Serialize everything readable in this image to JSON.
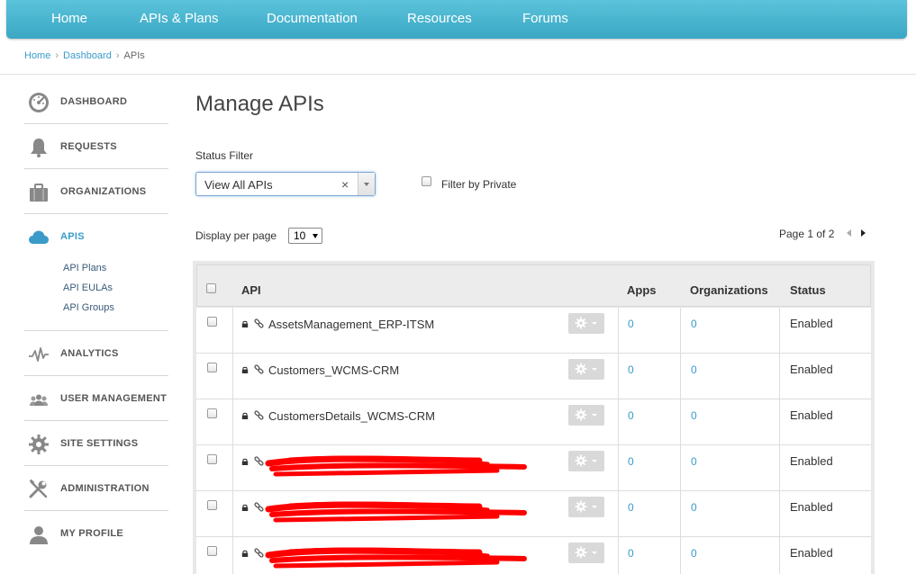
{
  "nav": {
    "items": [
      "Home",
      "APIs & Plans",
      "Documentation",
      "Resources",
      "Forums"
    ]
  },
  "breadcrumb": {
    "items": [
      "Home",
      "Dashboard",
      "APIs"
    ],
    "separator": "›"
  },
  "sidebar": {
    "items": [
      {
        "label": "DASHBOARD",
        "icon": "dashboard-icon"
      },
      {
        "label": "REQUESTS",
        "icon": "bell-icon"
      },
      {
        "label": "ORGANIZATIONS",
        "icon": "briefcase-icon"
      },
      {
        "label": "APIS",
        "icon": "cloud-icon",
        "active": true
      },
      {
        "label": "ANALYTICS",
        "icon": "pulse-icon"
      },
      {
        "label": "USER MANAGEMENT",
        "icon": "users-icon"
      },
      {
        "label": "SITE SETTINGS",
        "icon": "gear-icon"
      },
      {
        "label": "ADMINISTRATION",
        "icon": "tools-icon"
      },
      {
        "label": "MY PROFILE",
        "icon": "user-icon"
      }
    ],
    "apis_sub": [
      "API Plans",
      "API EULAs",
      "API Groups"
    ]
  },
  "main": {
    "title": "Manage APIs",
    "status_filter": {
      "label": "Status Filter",
      "value": "View All APIs",
      "clear": "×"
    },
    "filter_private": {
      "label": "Filter by Private",
      "checked": false
    },
    "display_per_page": {
      "label": "Display per page",
      "value": "10"
    },
    "pagination": {
      "text": "Page 1 of 2"
    }
  },
  "table": {
    "headers": {
      "api": "API",
      "apps": "Apps",
      "organizations": "Organizations",
      "status": "Status"
    },
    "rows": [
      {
        "name": "AssetsManagement_ERP-ITSM",
        "apps": "0",
        "orgs": "0",
        "status": "Enabled",
        "redacted": false
      },
      {
        "name": "Customers_WCMS-CRM",
        "apps": "0",
        "orgs": "0",
        "status": "Enabled",
        "redacted": false
      },
      {
        "name": "CustomersDetails_WCMS-CRM",
        "apps": "0",
        "orgs": "0",
        "status": "Enabled",
        "redacted": false
      },
      {
        "name": "",
        "apps": "0",
        "orgs": "0",
        "status": "Enabled",
        "redacted": true
      },
      {
        "name": "",
        "apps": "0",
        "orgs": "0",
        "status": "Enabled",
        "redacted": true
      },
      {
        "name": "",
        "apps": "0",
        "orgs": "0",
        "status": "Enabled",
        "redacted": true
      }
    ]
  },
  "colors": {
    "accent": "#3a9bc9",
    "nav_bg": "#48b3cf",
    "redaction": "#ff0000"
  }
}
